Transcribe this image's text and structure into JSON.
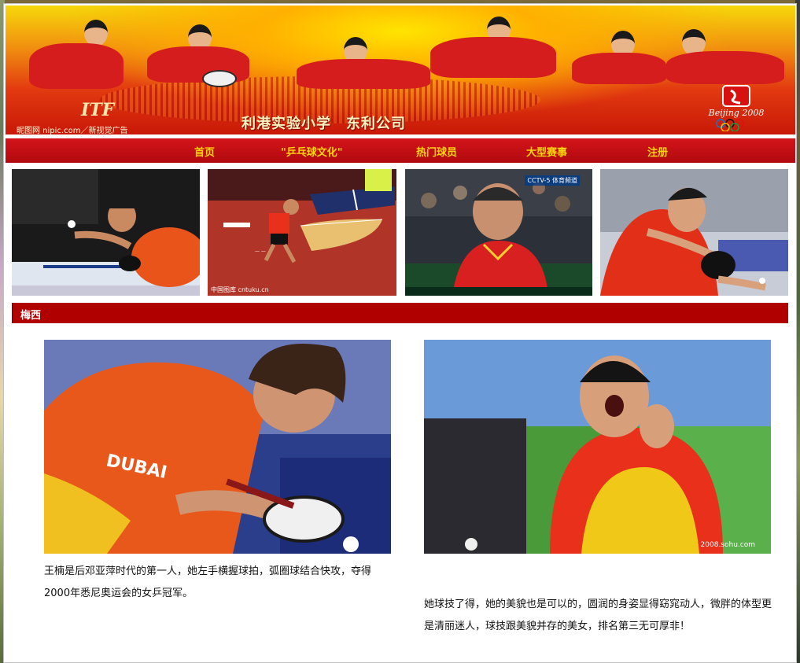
{
  "banner": {
    "caption": "利港实验小学　东利公司",
    "watermark": "昵图网 nipic.com／新视觉广告",
    "left_logo_text": "ITF",
    "olympic_text": "Beijing 2008",
    "colors": {
      "top": "#f6d80a",
      "bottom": "#c81808"
    }
  },
  "nav": {
    "items": [
      {
        "label": "首页"
      },
      {
        "label": "\"乒乓球文化\""
      },
      {
        "label": "热门球员"
      },
      {
        "label": "大型赛事"
      },
      {
        "label": "注册"
      }
    ],
    "colors": {
      "background": "#c20f14",
      "text": "#ffd60a"
    }
  },
  "thumbnails": {
    "captions": {
      "second": "中国图库 cntuku.cn",
      "third": "CCTV-5 体育频道"
    }
  },
  "section": {
    "title": "梅西",
    "color": "#b00000"
  },
  "main": {
    "left_description": "王楠是后邓亚萍时代的第一人，她左手横握球拍，弧圈球结合快攻，夺得2000年悉尼奥运会的女乒冠军。",
    "right_description": "她球技了得，她的美貌也是可以的，圆润的身姿显得窈窕动人，微胖的体型更是清丽迷人，球技跟美貌并存的美女，排名第三无可厚非！",
    "left_photo_jersey": "DUBAI",
    "right_photo_watermark": "2008.sohu.com"
  }
}
